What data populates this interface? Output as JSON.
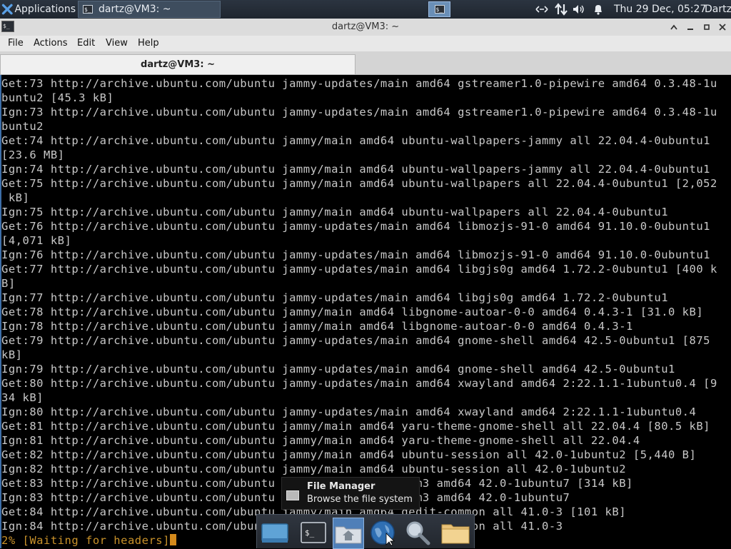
{
  "top_panel": {
    "applications_label": "Applications",
    "task_title": "dartz@VM3: ~",
    "clock": "Thu 29 Dec, 05:27",
    "username": "Dartz",
    "tray_icons": [
      "network-icon",
      "transfer-icon",
      "volume-icon",
      "notification-bell-icon"
    ]
  },
  "window": {
    "title": "dartz@VM3: ~",
    "menu": [
      "File",
      "Actions",
      "Edit",
      "View",
      "Help"
    ],
    "tab_title": "dartz@VM3: ~"
  },
  "terminal": {
    "lines": [
      "Get:73 http://archive.ubuntu.com/ubuntu jammy-updates/main amd64 gstreamer1.0-pipewire amd64 0.3.48-1u",
      "buntu2 [45.3 kB]",
      "Ign:73 http://archive.ubuntu.com/ubuntu jammy-updates/main amd64 gstreamer1.0-pipewire amd64 0.3.48-1u",
      "buntu2",
      "Get:74 http://archive.ubuntu.com/ubuntu jammy/main amd64 ubuntu-wallpapers-jammy all 22.04.4-0ubuntu1",
      "[23.6 MB]",
      "Ign:74 http://archive.ubuntu.com/ubuntu jammy/main amd64 ubuntu-wallpapers-jammy all 22.04.4-0ubuntu1",
      "Get:75 http://archive.ubuntu.com/ubuntu jammy/main amd64 ubuntu-wallpapers all 22.04.4-0ubuntu1 [2,052",
      " kB]",
      "Ign:75 http://archive.ubuntu.com/ubuntu jammy/main amd64 ubuntu-wallpapers all 22.04.4-0ubuntu1",
      "Get:76 http://archive.ubuntu.com/ubuntu jammy-updates/main amd64 libmozjs-91-0 amd64 91.10.0-0ubuntu1",
      "[4,071 kB]",
      "Ign:76 http://archive.ubuntu.com/ubuntu jammy-updates/main amd64 libmozjs-91-0 amd64 91.10.0-0ubuntu1",
      "Get:77 http://archive.ubuntu.com/ubuntu jammy-updates/main amd64 libgjs0g amd64 1.72.2-0ubuntu1 [400 k",
      "B]",
      "Ign:77 http://archive.ubuntu.com/ubuntu jammy-updates/main amd64 libgjs0g amd64 1.72.2-0ubuntu1",
      "Get:78 http://archive.ubuntu.com/ubuntu jammy/main amd64 libgnome-autoar-0-0 amd64 0.4.3-1 [31.0 kB]",
      "Ign:78 http://archive.ubuntu.com/ubuntu jammy/main amd64 libgnome-autoar-0-0 amd64 0.4.3-1",
      "Get:79 http://archive.ubuntu.com/ubuntu jammy-updates/main amd64 gnome-shell amd64 42.5-0ubuntu1 [875",
      "kB]",
      "Ign:79 http://archive.ubuntu.com/ubuntu jammy-updates/main amd64 gnome-shell amd64 42.5-0ubuntu1",
      "Get:80 http://archive.ubuntu.com/ubuntu jammy-updates/main amd64 xwayland amd64 2:22.1.1-1ubuntu0.4 [9",
      "34 kB]",
      "Ign:80 http://archive.ubuntu.com/ubuntu jammy-updates/main amd64 xwayland amd64 2:22.1.1-1ubuntu0.4",
      "Get:81 http://archive.ubuntu.com/ubuntu jammy/main amd64 yaru-theme-gnome-shell all 22.04.4 [80.5 kB]",
      "Ign:81 http://archive.ubuntu.com/ubuntu jammy/main amd64 yaru-theme-gnome-shell all 22.04.4",
      "Get:82 http://archive.ubuntu.com/ubuntu jammy/main amd64 ubuntu-session all 42.0-1ubuntu2 [5,440 B]",
      "Ign:82 http://archive.ubuntu.com/ubuntu jammy/main amd64 ubuntu-session all 42.0-1ubuntu2",
      "Get:83 http://archive.ubuntu.com/ubuntu jammy/main amd64 gdm3 amd64 42.0-1ubuntu7 [314 kB]",
      "Ign:83 http://archive.ubuntu.com/ubuntu jammy/main amd64 gdm3 amd64 42.0-1ubuntu7",
      "Get:84 http://archive.ubuntu.com/ubuntu jammy/main amd64 gedit-common all 41.0-3 [101 kB]",
      "Ign:84 http://archive.ubuntu.com/ubuntu jammy/main amd64 gedit-common all 41.0-3"
    ],
    "progress_line": "2% [Waiting for headers]"
  },
  "tooltip": {
    "title": "File Manager",
    "subtitle": "Browse the file system"
  },
  "dock": {
    "items": [
      "desktop-icon",
      "terminal-icon",
      "home-folder-icon",
      "web-browser-icon",
      "search-icon",
      "folder-icon"
    ]
  },
  "colors": {
    "panel_bg": "#1f262f",
    "terminal_bg": "#000000",
    "terminal_fg": "#c8c8c8",
    "progress_fg": "#c9922a",
    "accent": "#4f7fb8"
  }
}
